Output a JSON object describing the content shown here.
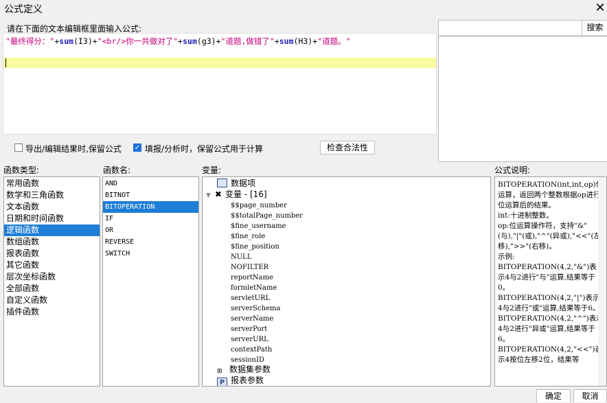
{
  "window": {
    "title": "公式定义",
    "close_icon": "close-icon"
  },
  "editor": {
    "prompt": "请在下面的文本编辑框里面输入公式:",
    "tokens": [
      {
        "t": "str",
        "v": "\"最终得分：\""
      },
      {
        "t": "op",
        "v": "+"
      },
      {
        "t": "fn",
        "v": "sum"
      },
      {
        "t": "op",
        "v": "(I3)+"
      },
      {
        "t": "str",
        "v": "\"<br/>你一共做对了\""
      },
      {
        "t": "op",
        "v": "+"
      },
      {
        "t": "fn",
        "v": "sum"
      },
      {
        "t": "op",
        "v": "(g3)+"
      },
      {
        "t": "str",
        "v": "\"道题,做错了\""
      },
      {
        "t": "op",
        "v": "+"
      },
      {
        "t": "fn",
        "v": "sum"
      },
      {
        "t": "op",
        "v": "(H3)+"
      },
      {
        "t": "str",
        "v": "\"道题。\""
      }
    ]
  },
  "search": {
    "placeholder": "",
    "button": "搜索"
  },
  "options": {
    "export_keep": {
      "label": "导出/编辑结果时,保留公式",
      "checked": false
    },
    "fill_keep": {
      "label": "填报/分析时，保留公式用于计算",
      "checked": true
    },
    "validate_button": "检查合法性"
  },
  "panels": {
    "func_type_label": "函数类型:",
    "func_name_label": "函数名:",
    "var_label": "变量:",
    "desc_label": "公式说明:"
  },
  "func_types": [
    "常用函数",
    "数学和三角函数",
    "文本函数",
    "日期和时间函数",
    "逻辑函数",
    "数组函数",
    "报表函数",
    "其它函数",
    "层次坐标函数",
    "全部函数",
    "自定义函数",
    "插件函数"
  ],
  "func_types_selected": 4,
  "func_names": [
    "AND",
    "BITNOT",
    "BITOPERATION",
    "IF",
    "OR",
    "REVERSE",
    "SWITCH"
  ],
  "func_names_selected": 2,
  "variables": {
    "data_item": "数据项",
    "var_group": "变量 - [16]",
    "vars": [
      "$$page_number",
      "$$totalPage_number",
      "$fine_username",
      "$fine_role",
      "$fine_position",
      "NULL",
      "NOFILTER",
      "reportName",
      "formletName",
      "servletURL",
      "serverSchema",
      "serverName",
      "serverPort",
      "serverURL",
      "contextPath",
      "sessionID"
    ],
    "dataset_params": "数据集参数",
    "report_params": "报表参数"
  },
  "description": "BITOPERATION(int,int,op)位运算，返回两个整数根据op进行位运算后的结果。\nint:十进制整数。\nop:位运算操作符，支持\"&\"(与),\"|\"(或),\"^\"(异或),\"<<\"(左移),\">>\"(右移)。\n示例:\nBITOPERATION(4,2,\"&\")表示4与2进行\"与\"运算,结果等于0。\nBITOPERATION(4,2,\"|\")表示4与2进行\"或\"运算,结果等于6。\nBITOPERATION(4,2,\"^\")表示4与2进行\"异或\"运算,结果等于6。\nBITOPERATION(4,2,\"<<\")表示4按位左移2位，结果等",
  "footer": {
    "ok": "确定",
    "cancel": "取消"
  }
}
